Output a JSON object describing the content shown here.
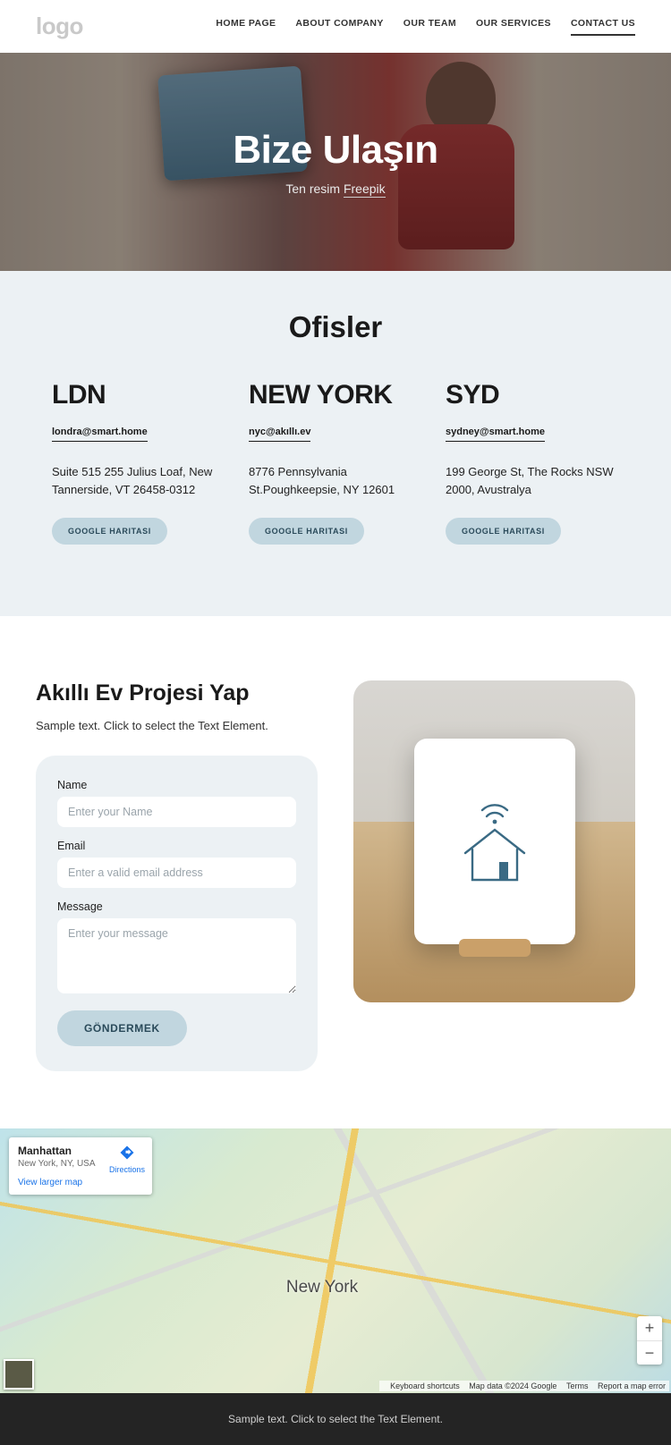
{
  "header": {
    "logo": "logo",
    "nav": [
      {
        "label": "HOME PAGE",
        "active": false
      },
      {
        "label": "ABOUT COMPANY",
        "active": false
      },
      {
        "label": "OUR TEAM",
        "active": false
      },
      {
        "label": "OUR SERVICES",
        "active": false
      },
      {
        "label": "CONTACT US",
        "active": true
      }
    ]
  },
  "hero": {
    "title": "Bize Ulaşın",
    "subtext_prefix": "Ten resim ",
    "subtext_link": "Freepik"
  },
  "offices": {
    "title": "Ofisler",
    "button_label": "GOOGLE HARITASI",
    "cols": [
      {
        "name": "LDN",
        "email": "londra@smart.home",
        "address": "Suite 515 255 Julius Loaf, New Tannerside, VT 26458-0312"
      },
      {
        "name": "NEW YORK",
        "email": "nyc@akıllı.ev",
        "address": "8776 Pennsylvania St.Poughkeepsie, NY 12601"
      },
      {
        "name": "SYD",
        "email": "sydney@smart.home",
        "address": "199 George St, The Rocks NSW 2000, Avustralya"
      }
    ]
  },
  "project": {
    "title": "Akıllı Ev Projesi Yap",
    "lead": "Sample text. Click to select the Text Element.",
    "form": {
      "name_label": "Name",
      "name_ph": "Enter your Name",
      "email_label": "Email",
      "email_ph": "Enter a valid email address",
      "msg_label": "Message",
      "msg_ph": "Enter your message",
      "submit": "GÖNDERMEK"
    }
  },
  "map": {
    "card_title": "Manhattan",
    "card_sub": "New York, NY, USA",
    "directions": "Directions",
    "view_larger": "View larger map",
    "city_label": "New York",
    "zoom_in": "+",
    "zoom_out": "−",
    "attrib_shortcuts": "Keyboard shortcuts",
    "attrib_data": "Map data ©2024 Google",
    "attrib_terms": "Terms",
    "attrib_report": "Report a map error"
  },
  "footer": {
    "text": "Sample text. Click to select the Text Element."
  },
  "colors": {
    "pill": "#c1d6df",
    "panel": "#ecf1f4",
    "footer": "#242424"
  }
}
